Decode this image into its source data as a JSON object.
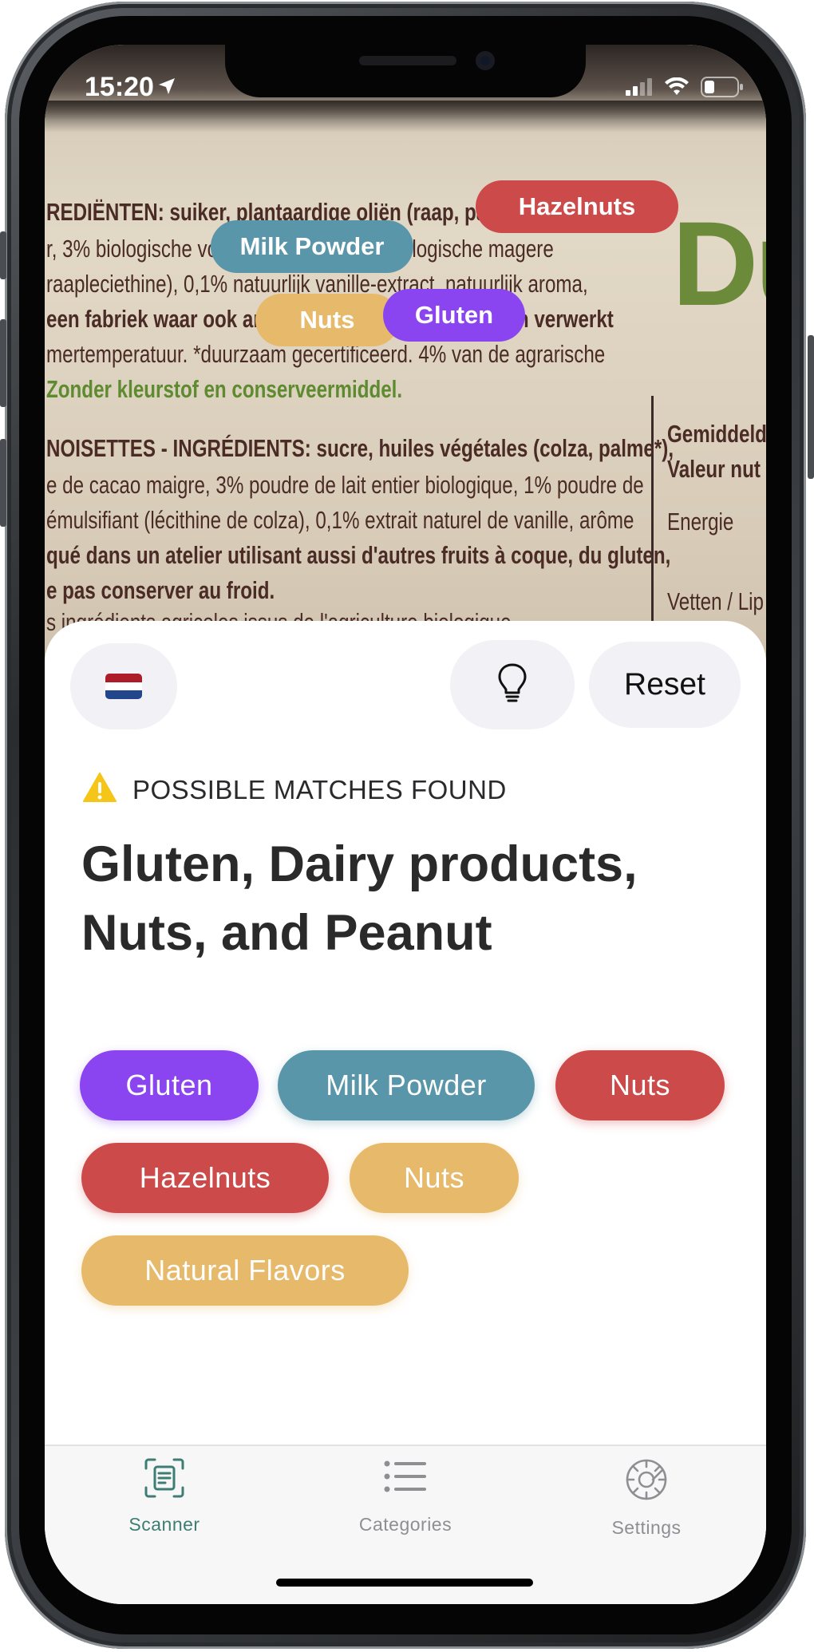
{
  "status": {
    "time": "15:20"
  },
  "camera": {
    "label_lines_left": [
      "REDIËNTEN: suiker, plantaardige oliën (raap, palm*),",
      "r, 3% biologische volle melkpoeder, 1% biologische magere",
      "raapleciethine), 0,1% natuurlijk vanille-extract, natuurlijk aroma,",
      "een fabriek waar ook andere noten en gluten worden verwerkt",
      "mertemperatuur. *duurzaam gecertificeerd. 4% van de agrarische",
      "Zonder kleurstof en conserveermiddel.",
      "NOISETTES - INGRÉDIENTS: sucre, huiles végétales (colza, palme*),",
      "e de cacao maigre, 3% poudre de lait entier biologique, 1% poudre de",
      "émulsifiant (lécithine de colza), 0,1% extrait naturel de vanille, arôme",
      "qué dans un atelier utilisant aussi d'autres fruits à coque, du gluten,",
      "e pas conserver au froid.",
      "s ingrédients agricoles issus de l'agriculture biologique"
    ],
    "label_lines_right": [
      "Gemiddeld",
      "Valeur nut",
      "Energie",
      "Vetten / Lip"
    ],
    "logo_text": "Du",
    "overlay_chips": [
      {
        "label": "Hazelnuts",
        "color": "#cd4a4a"
      },
      {
        "label": "Milk Powder",
        "color": "#5a96a9"
      },
      {
        "label": "Nuts",
        "color": "#e7b96a"
      },
      {
        "label": "Gluten",
        "color": "#8b45f0"
      }
    ]
  },
  "toolbar": {
    "flag_colors": [
      "#ae1c28",
      "#ffffff",
      "#21468b"
    ],
    "bulb_icon": "lightbulb-icon",
    "reset_label": "Reset"
  },
  "result": {
    "warning_icon": "warning-icon",
    "warning_color": "#f5c518",
    "warning_text": "POSSIBLE MATCHES FOUND",
    "headline": "Gluten, Dairy products, Nuts, and Peanut",
    "chips": [
      {
        "label": "Gluten",
        "color": "#8b45f0"
      },
      {
        "label": "Milk Powder",
        "color": "#5a96a9"
      },
      {
        "label": "Nuts",
        "color": "#cd4a4a"
      },
      {
        "label": "Hazelnuts",
        "color": "#cd4a4a"
      },
      {
        "label": "Nuts",
        "color": "#e7b96a"
      },
      {
        "label": "Natural Flavors",
        "color": "#e7b96a"
      }
    ]
  },
  "tabbar": {
    "active_color": "#3e7d73",
    "items": [
      {
        "label": "Scanner",
        "icon": "scanner-icon",
        "active": true
      },
      {
        "label": "Categories",
        "icon": "list-icon",
        "active": false
      },
      {
        "label": "Settings",
        "icon": "gear-icon",
        "active": false
      }
    ]
  }
}
